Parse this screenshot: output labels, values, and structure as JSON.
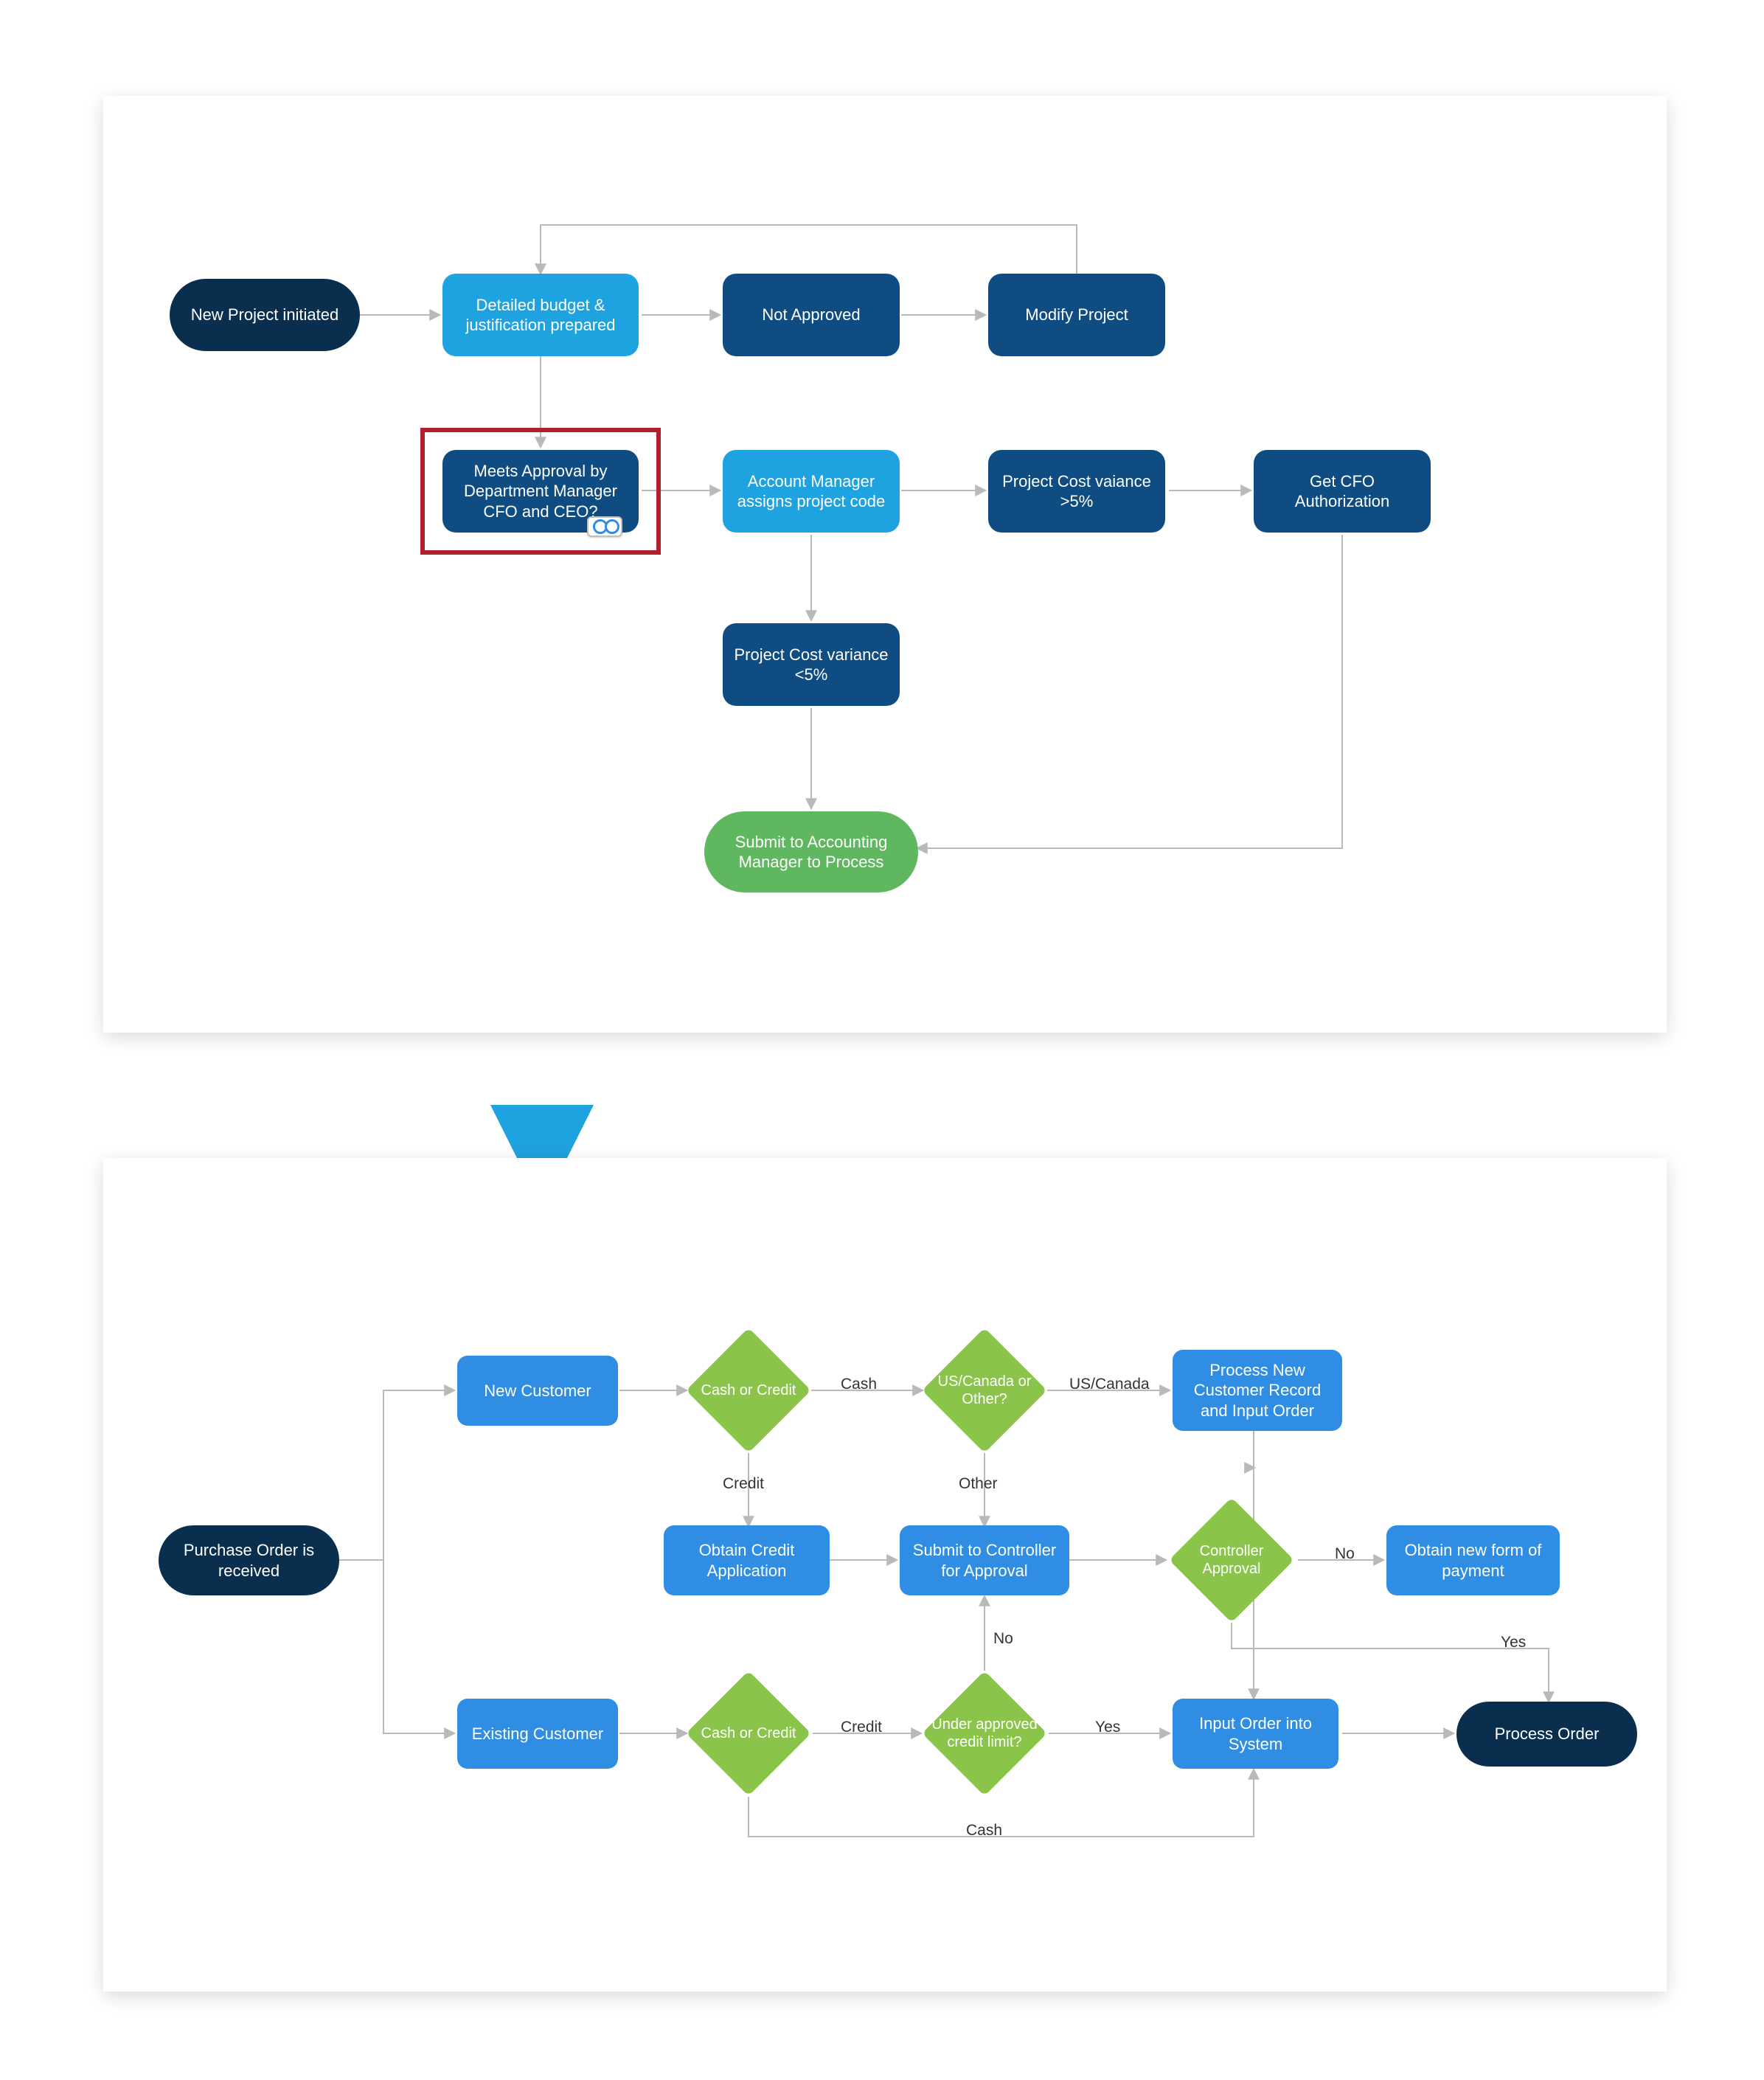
{
  "top": {
    "start": "New Project initiated",
    "budget": "Detailed budget & justification prepared",
    "not_approved": "Not Approved",
    "modify": "Modify Project",
    "approval": "Meets Approval by Department Manager CFO and CEO?",
    "assign_code": "Account Manager assigns project code",
    "var_gt5": "Project Cost vaiance >5%",
    "cfo_auth": "Get CFO Authorization",
    "var_lt5": "Project Cost variance <5%",
    "submit": "Submit to Accounting Manager to Process"
  },
  "bottom": {
    "start": "Purchase Order is received",
    "new_customer": "New Customer",
    "existing_customer": "Existing Customer",
    "cash_or_credit": "Cash or Credit",
    "us_canada": "US/Canada or Other?",
    "process_new": "Process New Customer Record and Input Order",
    "obtain_credit": "Obtain Credit Application",
    "submit_controller": "Submit to Controller for Approval",
    "controller_approval": "Controller Approval",
    "obtain_payment": "Obtain new form of payment",
    "under_limit": "Under approved credit limit?",
    "input_order": "Input Order into System",
    "process_order": "Process Order",
    "labels": {
      "cash": "Cash",
      "credit": "Credit",
      "us_canada": "US/Canada",
      "other": "Other",
      "yes": "Yes",
      "no": "No"
    }
  }
}
